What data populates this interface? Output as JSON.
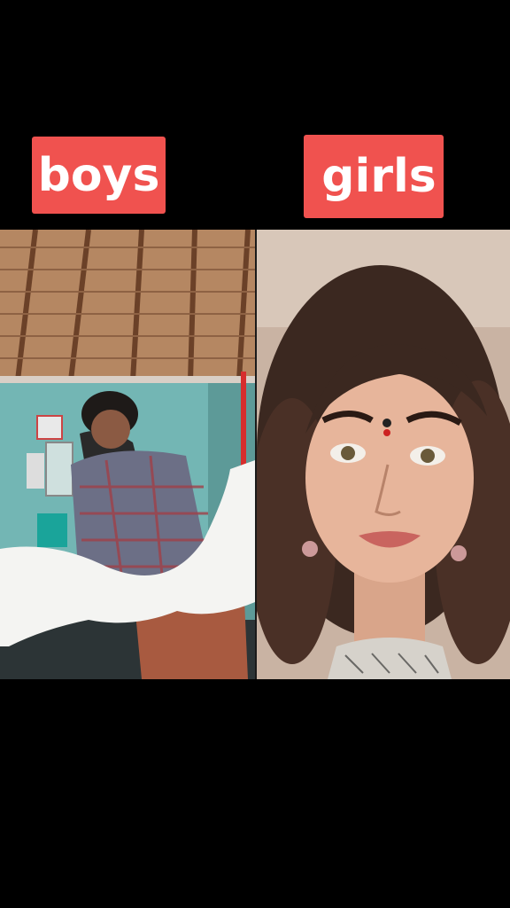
{
  "labels": {
    "left": "boys",
    "right": "girls"
  },
  "colors": {
    "background": "#000000",
    "label_background": "#f0524f",
    "label_text": "#ffffff"
  }
}
